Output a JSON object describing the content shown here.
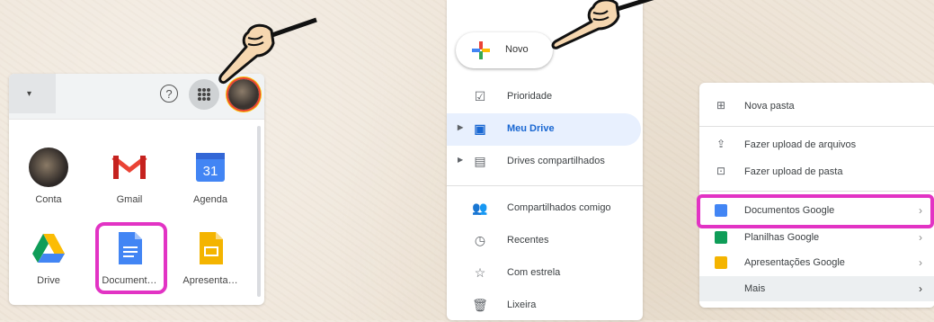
{
  "apps_panel": {
    "dropdown_arrow": "▾",
    "help_symbol": "?",
    "apps": [
      {
        "label": "Conta",
        "icon": "avatar-icon"
      },
      {
        "label": "Gmail",
        "icon": "gmail-icon"
      },
      {
        "label": "Agenda",
        "icon": "calendar-icon",
        "number": "31"
      },
      {
        "label": "Drive",
        "icon": "drive-icon"
      },
      {
        "label": "Document…",
        "icon": "docs-icon"
      },
      {
        "label": "Apresenta…",
        "icon": "slides-icon"
      }
    ]
  },
  "drive_sidebar": {
    "new_button": "Novo",
    "items": [
      {
        "label": "Prioridade",
        "icon": "priority-icon"
      },
      {
        "label": "Meu Drive",
        "icon": "my-drive-icon",
        "active": true
      },
      {
        "label": "Drives compartilhados",
        "icon": "shared-drives-icon"
      },
      {
        "label": "Compartilhados comigo",
        "icon": "shared-with-me-icon"
      },
      {
        "label": "Recentes",
        "icon": "clock-icon"
      },
      {
        "label": "Com estrela",
        "icon": "star-icon"
      },
      {
        "label": "Lixeira",
        "icon": "trash-icon"
      }
    ]
  },
  "new_menu": {
    "items": [
      {
        "label": "Nova pasta",
        "icon": "new-folder-icon"
      },
      {
        "label": "Fazer upload de arquivos",
        "icon": "file-upload-icon"
      },
      {
        "label": "Fazer upload de pasta",
        "icon": "folder-upload-icon"
      },
      {
        "label": "Documentos Google",
        "icon": "docs-icon",
        "chevron": "›"
      },
      {
        "label": "Planilhas Google",
        "icon": "sheets-icon",
        "chevron": "›"
      },
      {
        "label": "Apresentações Google",
        "icon": "slides-icon",
        "chevron": "›"
      },
      {
        "label": "Mais",
        "icon": "",
        "chevron": "›"
      }
    ]
  },
  "colors": {
    "highlight": "#e233c4",
    "docs_blue": "#4285f4",
    "sheets_green": "#0f9d58",
    "slides_yellow": "#f4b400",
    "active_blue": "#1967d2"
  }
}
